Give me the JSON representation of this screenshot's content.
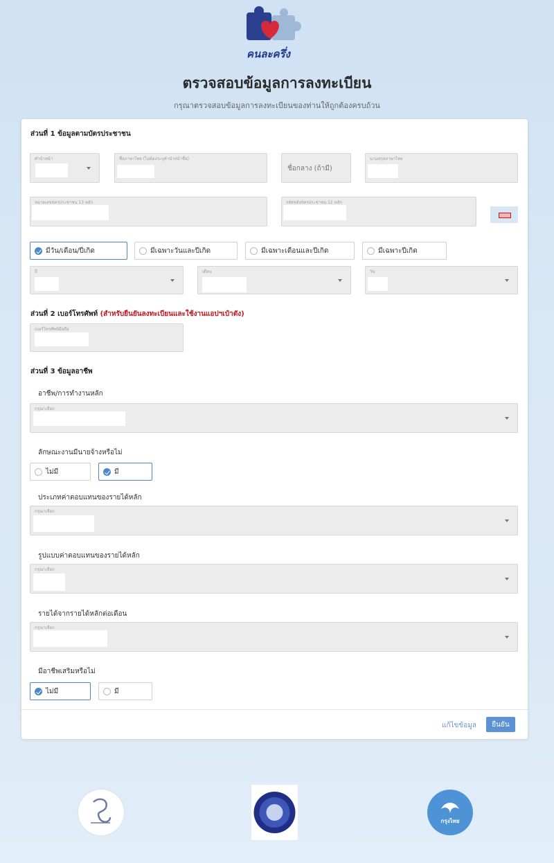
{
  "header": {
    "logo_text": "คนละครึ่ง",
    "title": "ตรวจสอบข้อมูลการลงทะเบียน",
    "subtitle": "กรุณาตรวจสอบข้อมูลการลงทะเบียนของท่านให้ถูกต้องครบถ้วน"
  },
  "section1": {
    "title": "ส่วนที่ 1 ข้อมูลตามบัตรประชาชน",
    "prefix_label": "คำนำหน้า",
    "firstname_label": "ชื่อภาษาไทย (ไม่ต้องระบุคำนำหน้าชื่อ)",
    "middlename_placeholder": "ชื่อกลาง (ถ้ามี)",
    "lastname_label": "นามสกุลภาษาไทย",
    "idcard_label": "หมายเลขบัตรประชาชน 13 หลัก",
    "laser_label": "รหัสหลังบัตรประชาชน 12 หลัก",
    "dob_options": [
      "มีวัน/เดือน/ปีเกิด",
      "มีเฉพาะวันและปีเกิด",
      "มีเฉพาะเดือนและปีเกิด",
      "มีเฉพาะปีเกิด"
    ],
    "year_label": "ปี",
    "month_label": "เดือน",
    "day_label": "วัน"
  },
  "section2": {
    "title": "ส่วนที่ 2 เบอร์โทรศัพท์",
    "title_note": "(สำหรับยืนยันลงทะเบียนและใช้งานแอปฯเป๋าตัง)",
    "phone_label": "เบอร์โทรศัพท์มือถือ"
  },
  "section3": {
    "title": "ส่วนที่ 3 ข้อมูลอาชีพ",
    "occupation_label": "อาชีพ/การทำงานหลัก",
    "select_placeholder": "กรุณาเลือก",
    "employer_question": "ลักษณะงานมีนายจ้างหรือไม่",
    "no_label": "ไม่มี",
    "yes_label": "มี",
    "income_type_label": "ประเภทค่าตอบแทนของรายได้หลัก",
    "income_form_label": "รูปแบบค่าตอบแทนของรายได้หลัก",
    "income_amount_label": "รายได้จากรายได้หลักต่อเดือน",
    "side_job_question": "มีอาชีพเสริมหรือไม่"
  },
  "footer": {
    "edit_link": "แก้ไขข้อมูล",
    "confirm_button": "ยืนยัน"
  },
  "bottom_logos": {
    "right_logo_text": "กรุงไทย"
  }
}
